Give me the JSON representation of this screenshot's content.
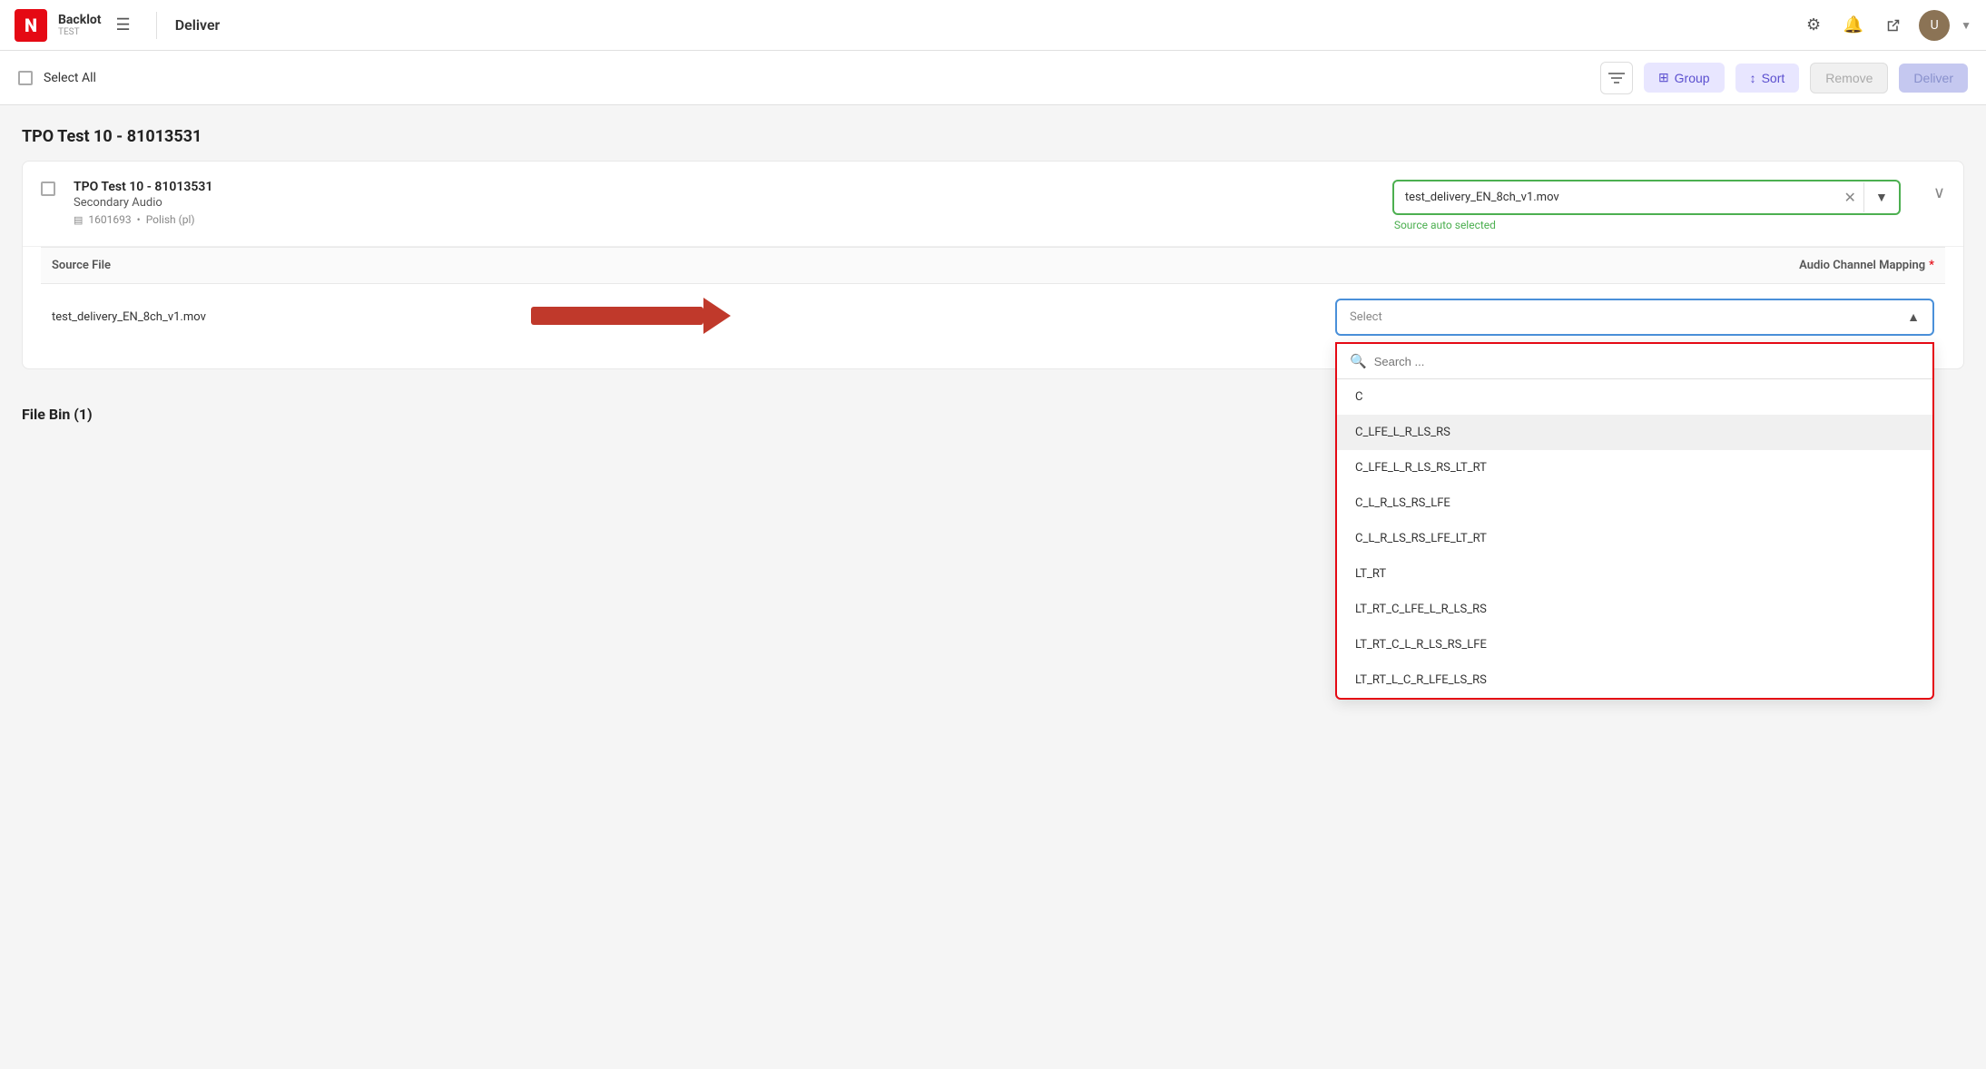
{
  "nav": {
    "logo_letter": "N",
    "app_name": "Backlot",
    "app_env": "TEST",
    "section": "Deliver",
    "avatar_initials": "U"
  },
  "toolbar": {
    "select_all": "Select All",
    "filter_label": "Filter",
    "group_label": "Group",
    "sort_label": "Sort",
    "remove_label": "Remove",
    "deliver_label": "Deliver"
  },
  "section": {
    "title": "TPO Test 10 - 81013531"
  },
  "card": {
    "title": "TPO Test 10 - 81013531",
    "subtitle": "Secondary Audio",
    "meta_id": "1601693",
    "meta_lang": "Polish (pl)",
    "source_file": "test_delivery_EN_8ch_v1.mov",
    "source_hint": "Source auto selected",
    "source_col_header": "Source File",
    "audio_col_header": "Audio Channel Mapping",
    "row_source": "test_delivery_EN_8ch_v1.mov"
  },
  "audio_mapping": {
    "placeholder": "Select",
    "search_placeholder": "Search ...",
    "options": [
      {
        "id": "c",
        "label": "C"
      },
      {
        "id": "c_lfe_l_r_ls_rs",
        "label": "C_LFE_L_R_LS_RS"
      },
      {
        "id": "c_lfe_l_r_ls_rs_lt_rt",
        "label": "C_LFE_L_R_LS_RS_LT_RT"
      },
      {
        "id": "c_l_r_ls_rs_lfe",
        "label": "C_L_R_LS_RS_LFE"
      },
      {
        "id": "c_l_r_ls_rs_lfe_lt_rt",
        "label": "C_L_R_LS_RS_LFE_LT_RT"
      },
      {
        "id": "lt_rt",
        "label": "LT_RT"
      },
      {
        "id": "lt_rt_c_lfe_l_r_ls_rs",
        "label": "LT_RT_C_LFE_L_R_LS_RS"
      },
      {
        "id": "lt_rt_c_l_r_ls_rs_lfe",
        "label": "LT_RT_C_L_R_LS_RS_LFE"
      },
      {
        "id": "lt_rt_l_c_r_lfe_ls_rs",
        "label": "LT_RT_L_C_R_LFE_LS_RS"
      }
    ],
    "highlighted_index": 1
  },
  "file_bin": {
    "title": "File Bin (1)"
  }
}
